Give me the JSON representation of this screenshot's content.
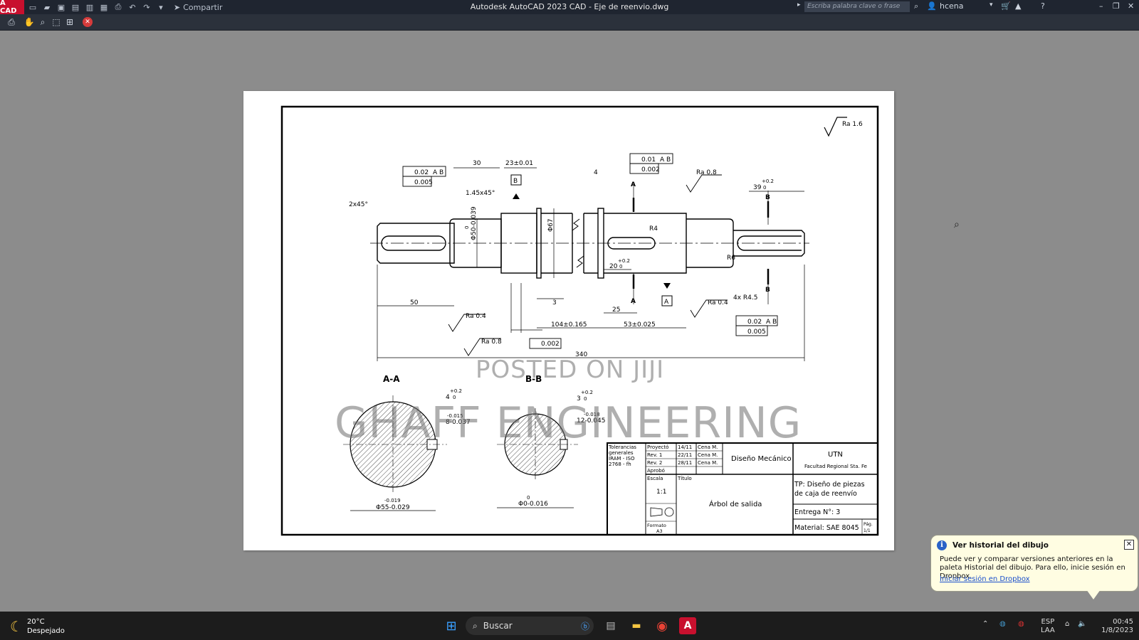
{
  "app": {
    "logo": "A CAD",
    "window_title": "Autodesk AutoCAD 2023    CAD - Eje de reenvio.dwg",
    "share_label": "Compartir",
    "search_placeholder": "Escriba palabra clave o frase",
    "user": "hcena"
  },
  "drawing": {
    "roughness_main": "Ra 1.6",
    "labels": {
      "chamfer": "2x45°",
      "dim_30": "30",
      "dim_23": "23±0.01",
      "dim_4": "4",
      "dim_39": "39",
      "dim_39_upper": "+0.2",
      "dim_39_lower": "0",
      "ra08_top": "Ra 0.8",
      "chamfer2": "1.45x45°",
      "datum_b": "B",
      "datum_a": "A",
      "diam50_nominal": "0",
      "diam50": "Φ50-0.039",
      "diam67": "Φ67",
      "r4": "R4",
      "dim_20": "20",
      "dim_20_upper": "+0.2",
      "dim_20_lower": "0",
      "r6": "R6",
      "r45": "4x R4.5",
      "dim_50": "50",
      "dim_3": "3",
      "dim_25": "25",
      "ra04_left": "Ra 0.4",
      "ra04_right": "Ra 0.4",
      "ra08_bottom": "Ra 0.8",
      "dim_104": "104±0.165",
      "dim_53": "53±0.025",
      "dim_340": "340",
      "sec_a": "A",
      "sec_b": "B",
      "runout_0002": "0.002",
      "fcf1_val1": "0.02",
      "fcf1_datum": "A B",
      "fcf1_val2": "0.005",
      "fcf2_val1": "0.01",
      "fcf2_datum": "A B",
      "fcf2_val2": "0.002",
      "fcf3_val1": "0.02",
      "fcf3_datum": "A B",
      "fcf3_val2": "0.005",
      "section_aa": "A-A",
      "section_bb": "B-B",
      "aa_dim4": "4",
      "aa_dim4_upper": "+0.2",
      "aa_dim4_lower": "0",
      "aa_dim8": "8-0.037",
      "aa_dim8_upper": "-0.015",
      "aa_diam55": "Φ55-0.029",
      "aa_diam55_upper": "-0.019",
      "bb_dim3": "3",
      "bb_dim3_upper": "+0.2",
      "bb_dim3_lower": "0",
      "bb_dim12": "12-0.045",
      "bb_dim12_upper": "-0.018",
      "bb_diam": "Φ0-0.016",
      "bb_diam_upper": "0"
    },
    "title_block": {
      "tolerances": [
        "Tolerancias",
        "generales",
        "IRAM - ISO",
        "2768 - fh"
      ],
      "rows": [
        {
          "label": "Proyectó",
          "date": "14/11",
          "name": "Cena M."
        },
        {
          "label": "Rev. 1",
          "date": "22/11",
          "name": "Cena M."
        },
        {
          "label": "Rev. 2",
          "date": "28/11",
          "name": "Cena M."
        },
        {
          "label": "Aprobó",
          "date": "",
          "name": ""
        }
      ],
      "subject": "Diseño Mecánico",
      "university": "UTN",
      "faculty": "Facultad Regional Sta. Fe",
      "scale_label": "Escala",
      "scale": "1:1",
      "title_label": "Título",
      "title": "Árbol de salida",
      "tp": "TP: Diseño de piezas de caja de reenvío",
      "tp_line1": "TP: Diseño de piezas",
      "tp_line2": "de caja de reenvío",
      "entrega": "Entrega N°: 3",
      "material": "Material: SAE 8045",
      "format_label": "Formato",
      "format": "A3",
      "page_label": "Pág.",
      "page": "1/1"
    }
  },
  "watermarks": {
    "line1": "POSTED ON JIJI",
    "line2": "GHAFF ENGINEERING"
  },
  "notification": {
    "title": "Ver historial del dibujo",
    "body": "Puede ver y comparar versiones anteriores en la paleta Historial del dibujo. Para ello, inicie sesión en Dropbox.",
    "link": "Iniciar sesión en Dropbox"
  },
  "taskbar": {
    "temperature": "20°C",
    "weather": "Despejado",
    "search": "Buscar",
    "lang1": "ESP",
    "lang2": "LAA",
    "time": "00:45",
    "date": "1/8/2023"
  }
}
